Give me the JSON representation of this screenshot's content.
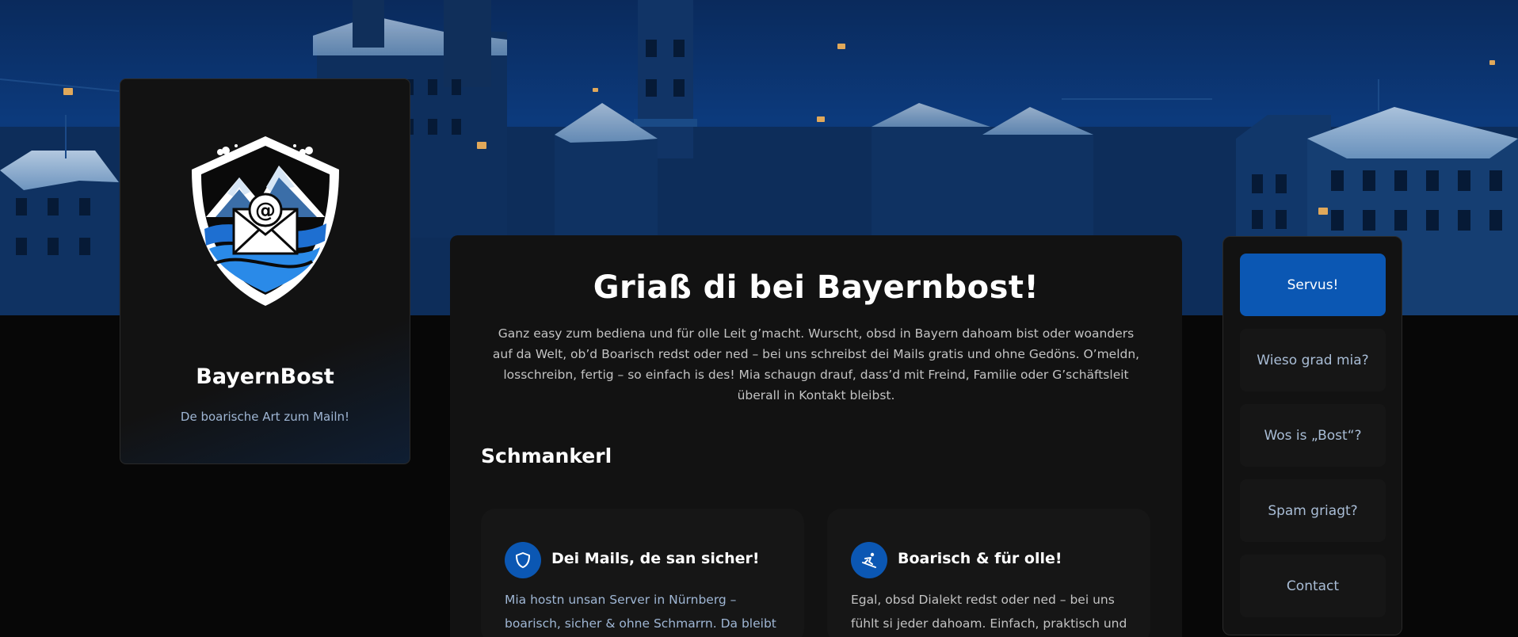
{
  "brand": {
    "name": "BayernBost",
    "tagline": "De boarische Art zum Mailn!"
  },
  "main": {
    "title": "Griaß di bei Bayernbost!",
    "intro": "Ganz easy zum bediena und für olle Leit g’macht. Wurscht, obsd in Bayern dahoam bist oder woanders auf da Welt, ob’d Boarisch redst oder ned – bei uns schreibst dei Mails gratis und ohne Gedöns. O’meldn, losschreibn, fertig – so einfach is des! Mia schaugn drauf, dass’d mit Freind, Familie oder G’schäftsleit überall in Kontakt bleibst.",
    "section_heading": "Schmankerl",
    "features": [
      {
        "icon": "shield-icon",
        "title": "Dei Mails, de san sicher!",
        "text": "Mia hostn unsan Server in Nürnberg – boarisch, sicher & ohne Schmarrn. Da bleibt"
      },
      {
        "icon": "skier-icon",
        "title": "Boarisch & für olle!",
        "text": "Egal, obsd Dialekt redst oder ned – bei uns fühlt si jeder dahoam. Einfach, praktisch und"
      }
    ]
  },
  "nav": {
    "items": [
      {
        "label": "Servus!",
        "active": true
      },
      {
        "label": "Wieso grad mia?",
        "active": false
      },
      {
        "label": "Wos is „Bost“?",
        "active": false
      },
      {
        "label": "Spam griagt?",
        "active": false
      },
      {
        "label": "Contact",
        "active": false
      }
    ]
  },
  "colors": {
    "accent": "#0b57b3",
    "background": "#070707",
    "panel": "#121212",
    "muted_text": "#9fb6d4"
  }
}
